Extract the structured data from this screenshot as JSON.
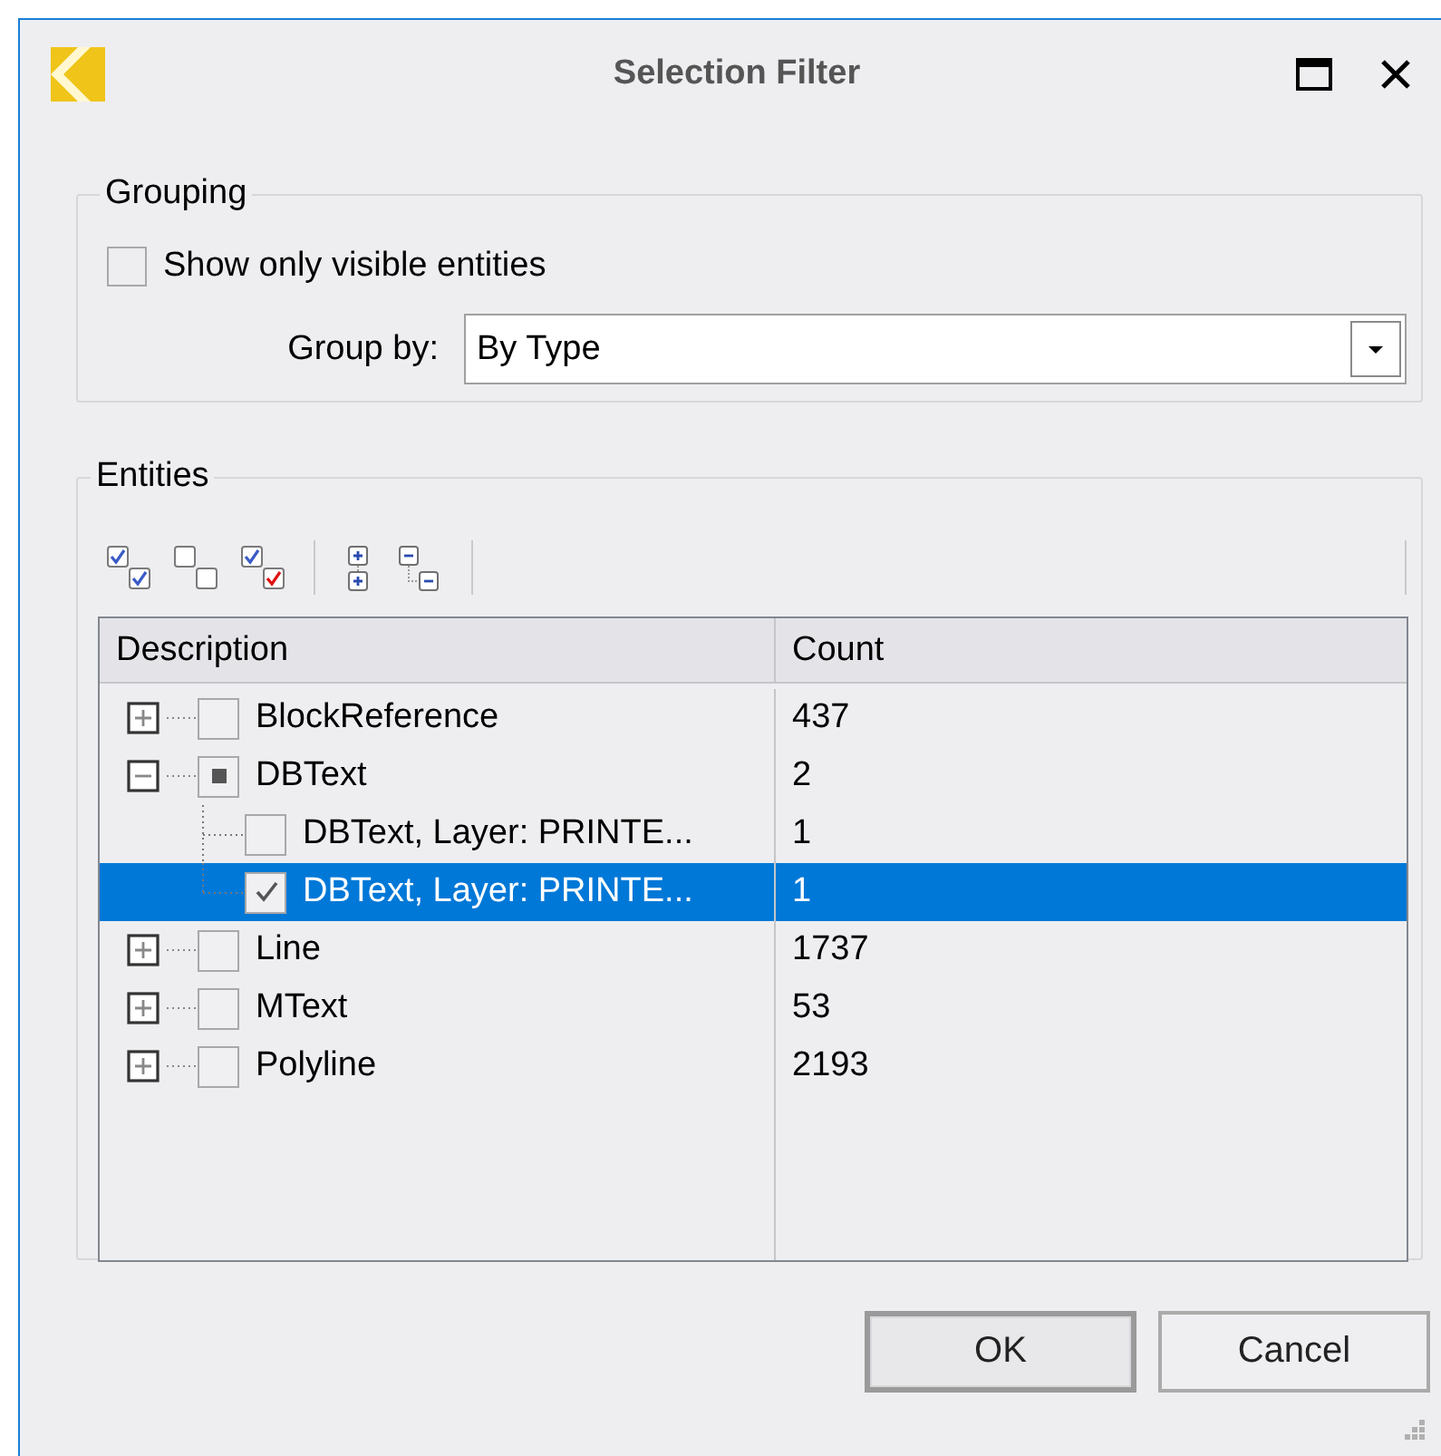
{
  "window": {
    "title": "Selection Filter"
  },
  "grouping": {
    "legend": "Grouping",
    "visible_only": {
      "label": "Show only visible entities",
      "checked": false
    },
    "group_by": {
      "label": "Group by:",
      "value": "By Type"
    }
  },
  "entities": {
    "legend": "Entities",
    "columns": [
      "Description",
      "Count"
    ],
    "rows": [
      {
        "description": "BlockReference",
        "count": "437",
        "checked": false,
        "indeterminate": false,
        "expanded": false,
        "selected": false
      },
      {
        "description": "DBText",
        "count": "2",
        "checked": false,
        "indeterminate": true,
        "expanded": true,
        "selected": false,
        "children": [
          {
            "description": "DBText, Layer: PRINTE...",
            "count": "1",
            "checked": false,
            "indeterminate": false,
            "selected": false
          },
          {
            "description": "DBText, Layer: PRINTE...",
            "count": "1",
            "checked": true,
            "indeterminate": false,
            "selected": true
          }
        ]
      },
      {
        "description": "Line",
        "count": "1737",
        "checked": false,
        "indeterminate": false,
        "expanded": false,
        "selected": false
      },
      {
        "description": "MText",
        "count": "53",
        "checked": false,
        "indeterminate": false,
        "expanded": false,
        "selected": false
      },
      {
        "description": "Polyline",
        "count": "2193",
        "checked": false,
        "indeterminate": false,
        "expanded": false,
        "selected": false
      }
    ]
  },
  "buttons": [
    {
      "label": "OK",
      "default": true
    },
    {
      "label": "Cancel",
      "default": false
    }
  ]
}
